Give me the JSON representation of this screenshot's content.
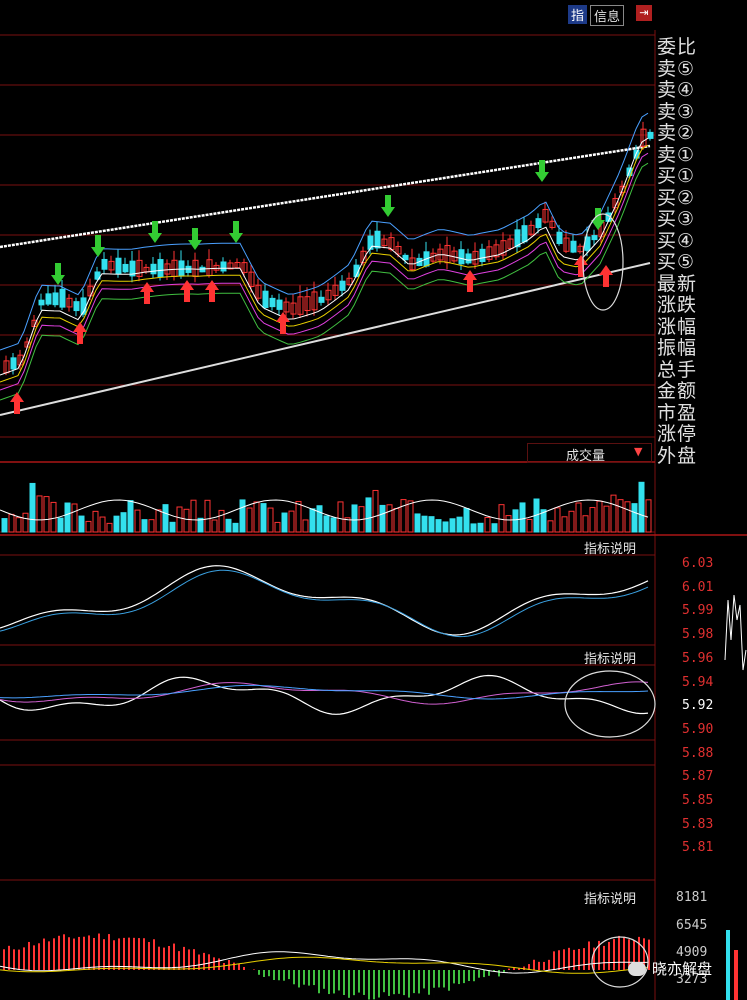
{
  "header": {
    "icon_label": "指",
    "info_label": "信息",
    "pin_icon": "pin-icon"
  },
  "side_panel": {
    "rows": [
      "委比",
      "卖⑤",
      "卖④",
      "卖③",
      "卖②",
      "卖①",
      "买①",
      "买②",
      "买③",
      "买④",
      "买⑤",
      "最新",
      "涨跌",
      "涨幅",
      "振幅",
      "总手",
      "金额",
      "市盈",
      "涨停",
      "外盘"
    ]
  },
  "volume_panel": {
    "label": "成交量",
    "dropdown_icon": "triangle-down-icon"
  },
  "indicator_panels": [
    {
      "label": "指标说明"
    },
    {
      "label": "指标说明"
    },
    {
      "label": "指标说明"
    }
  ],
  "price_scale": {
    "values": [
      "6.03",
      "6.01",
      "5.99",
      "5.98",
      "5.96",
      "5.94",
      "5.92",
      "5.90",
      "5.88",
      "5.87",
      "5.85",
      "5.83",
      "5.81"
    ],
    "highlight_value": "5.92"
  },
  "volume_scale": {
    "values": [
      "8181",
      "6545",
      "4909",
      "3273"
    ]
  },
  "watermark": {
    "text": "晓亦解盘"
  },
  "colors": {
    "up": "#ff3333",
    "down": "#33e0ee",
    "grid": "#7a1010",
    "green_arrow": "#33cc33",
    "red_arrow": "#ff3333",
    "trendline": "#ffffff"
  }
}
